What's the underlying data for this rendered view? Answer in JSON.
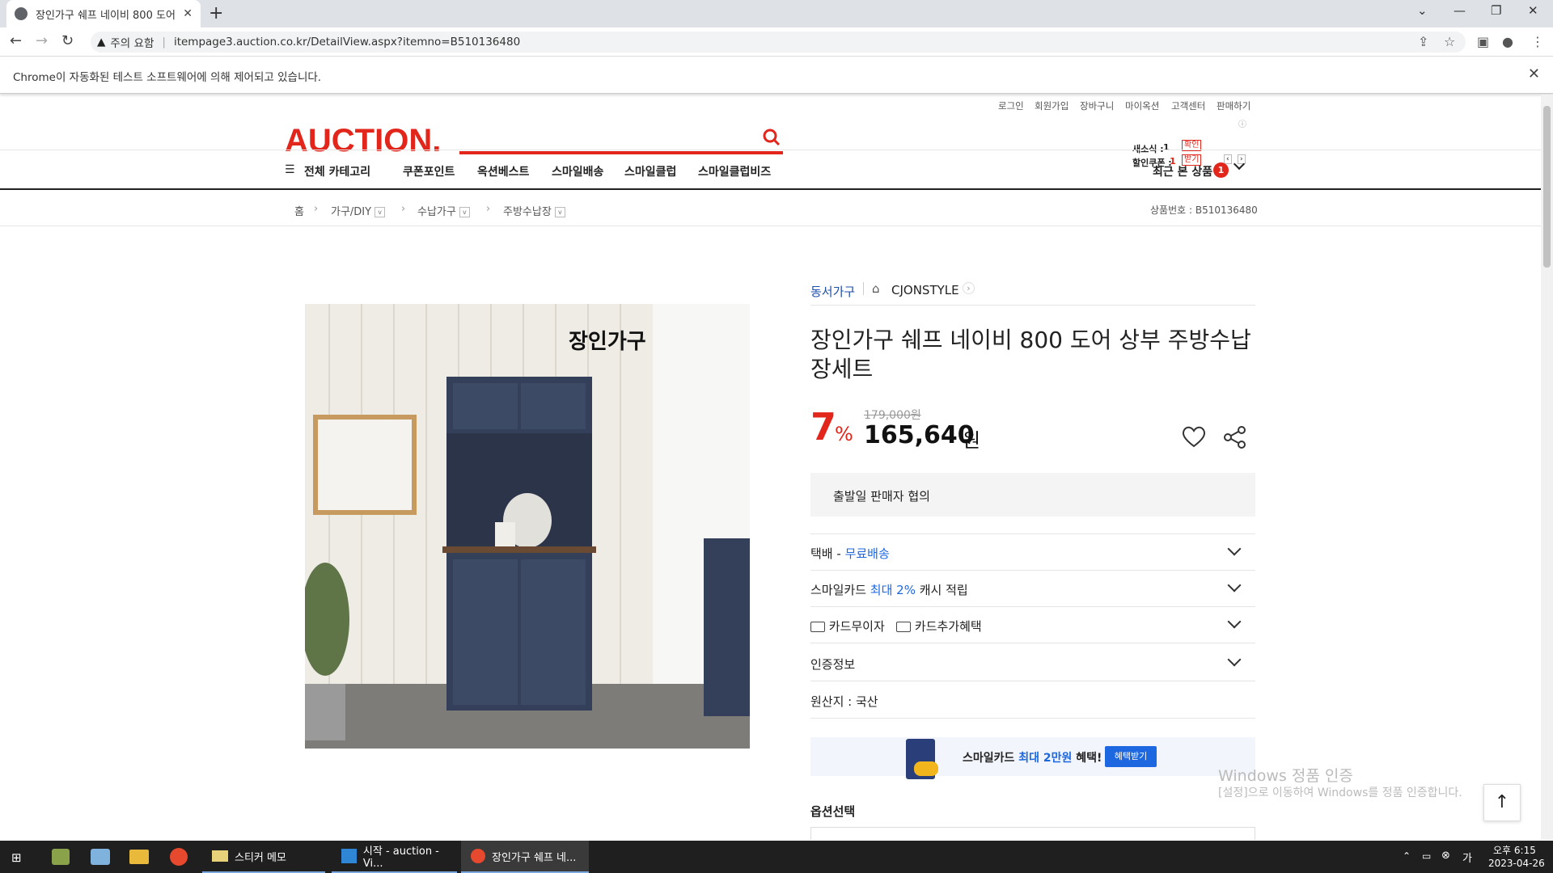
{
  "browser": {
    "tab_title": "장인가구 쉐프 네이비 800 도어",
    "security_label": "주의 요함",
    "separator": "|",
    "url": "itempage3.auction.co.kr/DetailView.aspx?itemno=B510136480",
    "infobar_text": "Chrome이 자동화된 테스트 소프트웨어에 의해 제어되고 있습니다."
  },
  "header": {
    "util_links": [
      "로그인",
      "회원가입",
      "장바구니",
      "마이옥션",
      "고객센터",
      "판매하기"
    ],
    "logo": "AUCTION.",
    "news_label": "새소식 :",
    "news_count": "1",
    "news_btn": "확인",
    "coupon_label": "할인쿠폰 :",
    "coupon_count": "1",
    "coupon_btn": "받기"
  },
  "gnb": {
    "all_categories": "전체 카테고리",
    "items": [
      "쿠폰포인트",
      "옥션베스트",
      "스마일배송",
      "스마일클럽",
      "스마일클럽비즈"
    ],
    "recent_label": "최근 본 상품",
    "recent_count": "1"
  },
  "breadcrumb": {
    "home": "홈",
    "items": [
      "가구/DIY",
      "수납가구",
      "주방수납장"
    ],
    "product_no": "상품번호 : B510136480"
  },
  "product": {
    "brand": "동서가구",
    "store": "CJONSTYLE",
    "title": "장인가구 쉐프 네이비 800 도어 상부 주방수납장세트",
    "image_logo": "장인가구",
    "discount": "7",
    "discount_unit": "%",
    "original_price": "179,000원",
    "price": "165,640",
    "price_unit": "원",
    "shipping_date": "출발일 판매자 협의",
    "delivery_label": "택배 - ",
    "delivery_value": "무료배송",
    "smilecard_label": "스마일카드 ",
    "smilecard_value": "최대 2%",
    "smilecard_suffix": " 캐시 적립",
    "card_interest": "카드무이자",
    "card_benefit": "카드추가혜택",
    "cert": "인증정보",
    "origin": "원산지 : 국산",
    "banner_text_1": "스마일카드 ",
    "banner_text_2": "최대 2만원",
    "banner_text_3": " 혜택!",
    "banner_btn": "혜택받기",
    "option_label": "옵션선택"
  },
  "watermark": {
    "line1": "Windows 정품 인증",
    "line2": "[설정]으로 이동하여 Windows를 정품 인증합니다."
  },
  "taskbar": {
    "apps": [
      "스티커 메모",
      "시작 - auction - Vi...",
      "장인가구 쉐프 네..."
    ],
    "time": "오후 6:15",
    "date": "2023-04-26"
  }
}
